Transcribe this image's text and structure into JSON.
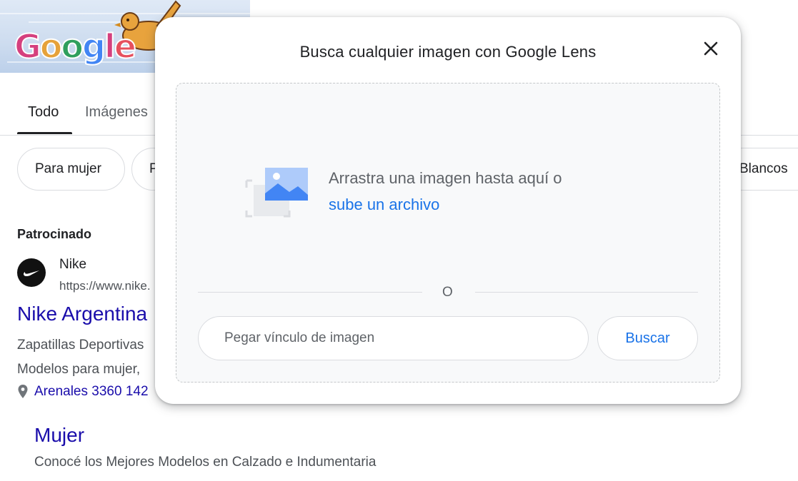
{
  "doodle": {
    "logo_letters": [
      "G",
      "o",
      "o",
      "g",
      "l",
      "e"
    ],
    "logo_colors": [
      "#d5407e",
      "#e6a23a",
      "#2f9f5d",
      "#4285f4",
      "#d5407e",
      "#e6505e"
    ]
  },
  "tabs": [
    {
      "label": "Todo",
      "active": true
    },
    {
      "label": "Imágenes",
      "active": false
    }
  ],
  "chips": [
    "Para mujer",
    "P",
    "Blancos"
  ],
  "ad": {
    "sponsored_label": "Patrocinado",
    "advertiser": "Nike",
    "url": "https://www.nike.",
    "title": "Nike Argentina",
    "desc_line1": "Zapatillas Deportivas",
    "desc_line2": "Modelos para mujer,",
    "address": "Arenales 3360 142",
    "sitelink_title": "Mujer",
    "sitelink_desc": "Conocé los Mejores Modelos en Calzado e Indumentaria"
  },
  "lens_modal": {
    "title": "Busca cualquier imagen con Google Lens",
    "drag_text": "Arrastra una imagen hasta aquí o",
    "upload_link": "sube un archivo",
    "or_text": "O",
    "url_placeholder": "Pegar vínculo de imagen",
    "search_button": "Buscar",
    "close_icon": "close-icon",
    "accent_color": "#1a73e8"
  }
}
